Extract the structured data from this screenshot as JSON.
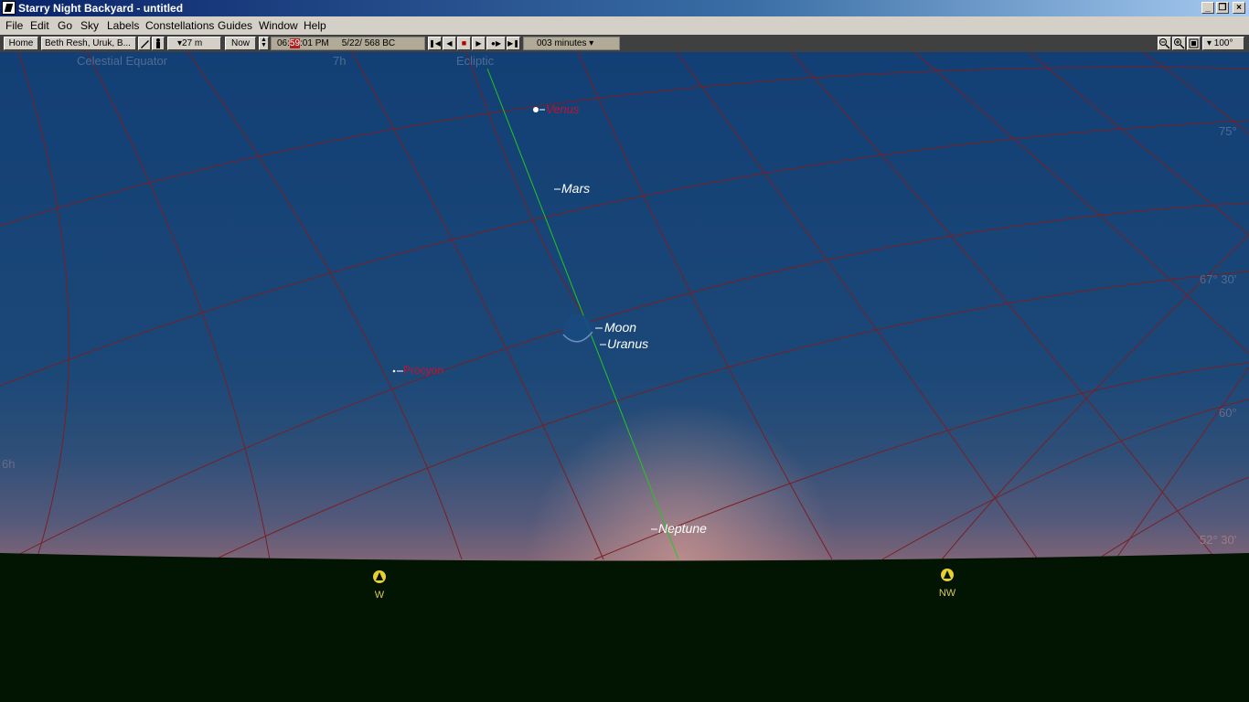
{
  "window": {
    "title": "Starry Night Backyard - untitled"
  },
  "menu": [
    "File",
    "Edit",
    "Go",
    "Sky",
    "Labels",
    "Constellations",
    "Guides",
    "Window",
    "Help"
  ],
  "toolbar": {
    "home_label": "Home",
    "location": "Beth Resh, Uruk, B...",
    "elevation": "▾27 m",
    "now_label": "Now",
    "time_prefix": "06:",
    "time_minutes": "59",
    "time_suffix": ":01 PM",
    "date": "5/22/  568 BC",
    "step": "003 minutes ▾",
    "zoom": "▾ 100°"
  },
  "sky": {
    "guide_labels": {
      "celestial_equator": "Celestial Equator",
      "ecliptic": "Ecliptic"
    },
    "ra_labels": {
      "seven_h": "7h",
      "six_h": "6h"
    },
    "dec_labels": {
      "d75": "75°",
      "d67": "67° 30'",
      "d60": "60°",
      "d52": "52° 30'"
    },
    "objects": {
      "venus": "Venus",
      "mars": "Mars",
      "moon": "Moon",
      "uranus": "Uranus",
      "procyon": "Procyon",
      "neptune": "Neptune"
    },
    "compass": {
      "west": "W",
      "northwest": "NW"
    }
  },
  "colors": {
    "sky_top": "#123f75",
    "horizon_glow": "#a36f70",
    "ground": "#021402",
    "grid": "#7a1f22",
    "ecliptic": "#22c81c",
    "label_red": "#c8102e",
    "label_white": "#ffffff"
  }
}
